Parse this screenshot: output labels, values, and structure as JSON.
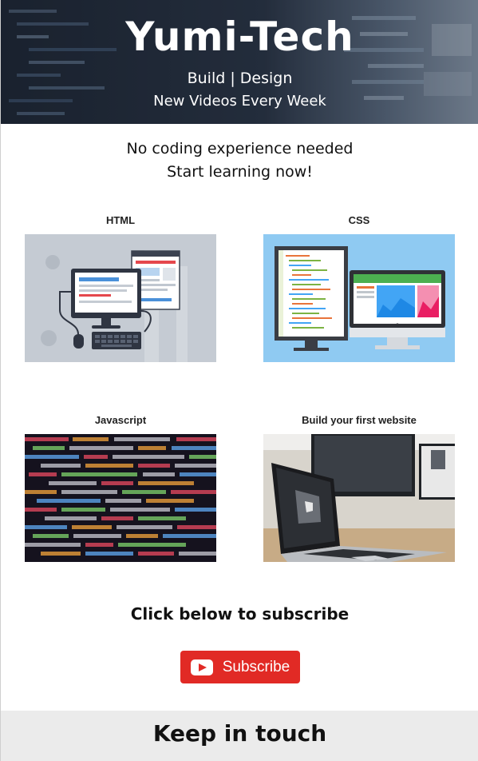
{
  "hero": {
    "title": "Yumi-Tech",
    "tagline": "Build | Design",
    "schedule": "New Videos Every Week"
  },
  "intro": {
    "line1": "No coding experience needed",
    "line2": "Start learning now!"
  },
  "courses": [
    {
      "label": "HTML",
      "image": "desktop-computer-illustration"
    },
    {
      "label": "CSS",
      "image": "monitors-code-illustration"
    },
    {
      "label": "Javascript",
      "image": "code-screen-photo"
    },
    {
      "label": "Build your first website",
      "image": "laptop-desk-photo"
    }
  ],
  "subscribe": {
    "heading": "Click below to subscribe",
    "button_label": "Subscribe",
    "icon": "youtube-play-icon",
    "color": "#e12a25"
  },
  "footer": {
    "title": "Keep in touch",
    "background": "#ebebeb"
  }
}
